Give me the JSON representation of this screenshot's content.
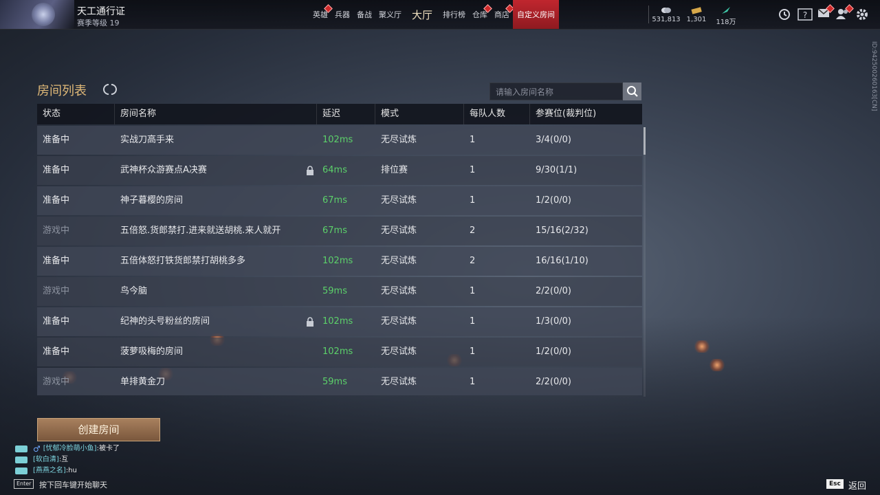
{
  "colors": {
    "accent_gold": "#e0b978",
    "ping_green": "#5cd16a",
    "nav_active": "#c0262e",
    "status_playing": "#8d93a0"
  },
  "header": {
    "pass_title": "天工通行证",
    "season_level": "赛季等级 19",
    "nav": [
      {
        "label": "英雄",
        "badge": true
      },
      {
        "label": "兵器",
        "badge": false
      },
      {
        "label": "备战",
        "badge": false
      },
      {
        "label": "聚义厅",
        "badge": false
      },
      {
        "label": "大厅",
        "badge": false,
        "big": true
      },
      {
        "label": "排行榜",
        "badge": false
      },
      {
        "label": "仓库",
        "badge": true
      },
      {
        "label": "商店",
        "badge": true
      },
      {
        "label": "自定义房间",
        "badge": false,
        "active": true
      }
    ],
    "resources": [
      {
        "icon": "coin-icon",
        "value": "531,813"
      },
      {
        "icon": "ticket-icon",
        "value": "1,301"
      },
      {
        "icon": "feather-icon",
        "value": "118万"
      }
    ],
    "tools": [
      "timer-icon",
      "help-icon",
      "mail-icon",
      "friends-icon",
      "settings-icon"
    ]
  },
  "side_id": "ID:942500260163[CN]",
  "room_list": {
    "title": "房间列表",
    "search_placeholder": "请输入房间名称",
    "columns": [
      "状态",
      "房间名称",
      "延迟",
      "模式",
      "每队人数",
      "参赛位(裁判位)"
    ],
    "rows": [
      {
        "status": "准备中",
        "playing": false,
        "name": "实战刀高手来",
        "locked": false,
        "ping": "102ms",
        "mode": "无尽试炼",
        "per_team": "1",
        "slots": "3/4(0/0)"
      },
      {
        "status": "准备中",
        "playing": false,
        "name": "武神杯众游赛点A决赛",
        "locked": true,
        "ping": "64ms",
        "mode": "排位赛",
        "per_team": "1",
        "slots": "9/30(1/1)"
      },
      {
        "status": "准备中",
        "playing": false,
        "name": "神子暮樱的房间",
        "locked": false,
        "ping": "67ms",
        "mode": "无尽试炼",
        "per_team": "1",
        "slots": "1/2(0/0)"
      },
      {
        "status": "游戏中",
        "playing": true,
        "name": "五倍怒.货郎禁打.进来就送胡桃.来人就开",
        "locked": false,
        "ping": "67ms",
        "mode": "无尽试炼",
        "per_team": "2",
        "slots": "15/16(2/32)"
      },
      {
        "status": "准备中",
        "playing": false,
        "name": "五倍体怒打铁货郎禁打胡桃多多",
        "locked": false,
        "ping": "102ms",
        "mode": "无尽试炼",
        "per_team": "2",
        "slots": "16/16(1/10)"
      },
      {
        "status": "游戏中",
        "playing": true,
        "name": "鸟今脑",
        "locked": false,
        "ping": "59ms",
        "mode": "无尽试炼",
        "per_team": "1",
        "slots": "2/2(0/0)"
      },
      {
        "status": "准备中",
        "playing": false,
        "name": "纪神的头号粉丝的房间",
        "locked": true,
        "ping": "102ms",
        "mode": "无尽试炼",
        "per_team": "1",
        "slots": "1/3(0/0)"
      },
      {
        "status": "准备中",
        "playing": false,
        "name": "菠萝吸梅的房间",
        "locked": false,
        "ping": "102ms",
        "mode": "无尽试炼",
        "per_team": "1",
        "slots": "1/2(0/0)"
      },
      {
        "status": "游戏中",
        "playing": true,
        "name": "单排黄金刀",
        "locked": false,
        "ping": "59ms",
        "mode": "无尽试炼",
        "per_team": "1",
        "slots": "2/2(0/0)"
      }
    ]
  },
  "create_button": "创建房间",
  "chat": [
    {
      "name": "[忧郁冷脸萌小鱼]",
      "msg": ":被卡了",
      "male": true
    },
    {
      "name": "[软白清]",
      "msg": ":互",
      "male": false
    },
    {
      "name": "[燕燕之名]",
      "msg": ":hu",
      "male": false
    }
  ],
  "chat_hint": {
    "key": "Enter",
    "text": "按下回车键开始聊天"
  },
  "back": {
    "key": "Esc",
    "label": "返回"
  }
}
